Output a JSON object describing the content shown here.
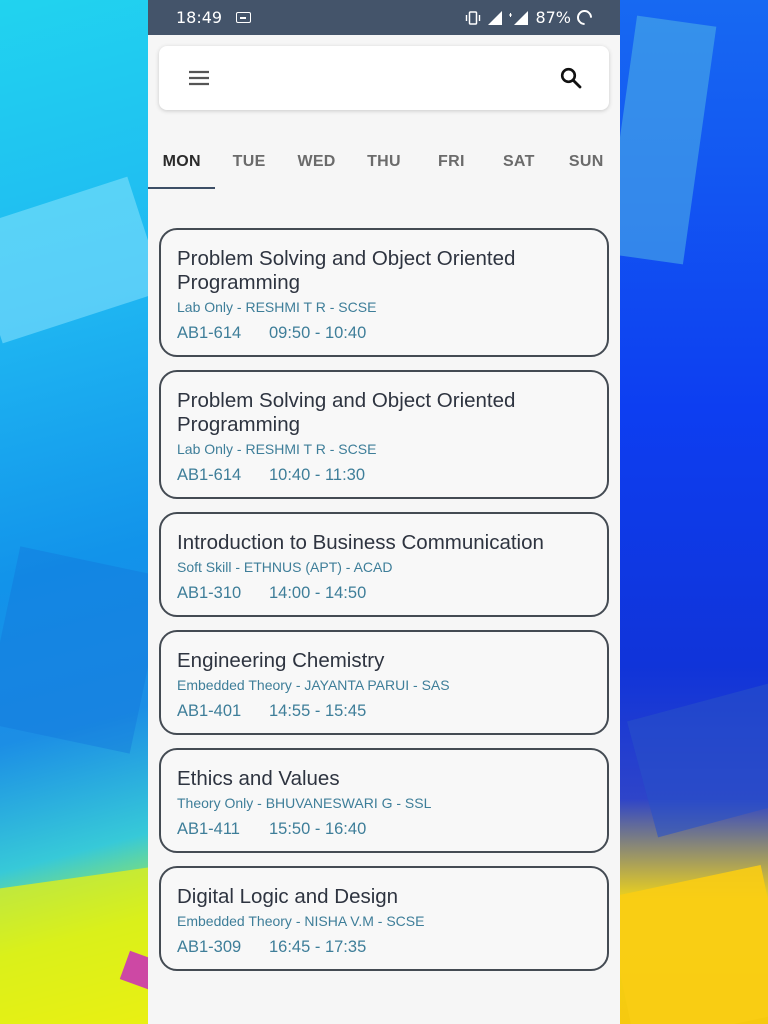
{
  "status_bar": {
    "time": "18:49",
    "battery": "87%",
    "network": "4G"
  },
  "search_bar": {
    "menu_icon": "menu-icon",
    "search_icon": "search-icon"
  },
  "tabs": [
    {
      "label": "MON",
      "active": true
    },
    {
      "label": "TUE",
      "active": false
    },
    {
      "label": "WED",
      "active": false
    },
    {
      "label": "THU",
      "active": false
    },
    {
      "label": "FRI",
      "active": false
    },
    {
      "label": "SAT",
      "active": false
    },
    {
      "label": "SUN",
      "active": false
    }
  ],
  "classes": [
    {
      "title": "Problem Solving and Object Oriented Programming",
      "subtitle": "Lab Only - RESHMI T R - SCSE",
      "room": "AB1-614",
      "time": "09:50 - 10:40"
    },
    {
      "title": "Problem Solving and Object Oriented Programming",
      "subtitle": "Lab Only - RESHMI T R - SCSE",
      "room": "AB1-614",
      "time": "10:40 - 11:30"
    },
    {
      "title": "Introduction to Business Communication",
      "subtitle": "Soft Skill - ETHNUS (APT) - ACAD",
      "room": "AB1-310",
      "time": "14:00 - 14:50"
    },
    {
      "title": "Engineering Chemistry",
      "subtitle": "Embedded Theory - JAYANTA PARUI - SAS",
      "room": "AB1-401",
      "time": "14:55 - 15:45"
    },
    {
      "title": "Ethics and Values",
      "subtitle": "Theory Only - BHUVANESWARI G - SSL",
      "room": "AB1-411",
      "time": "15:50 - 16:40"
    },
    {
      "title": "Digital Logic and Design",
      "subtitle": "Embedded Theory - NISHA V.M - SCSE",
      "room": "AB1-309",
      "time": "16:45 - 17:35"
    }
  ],
  "colors": {
    "status_bar": "#44546a",
    "accent_text": "#3e7e99",
    "card_border": "#444b53"
  }
}
